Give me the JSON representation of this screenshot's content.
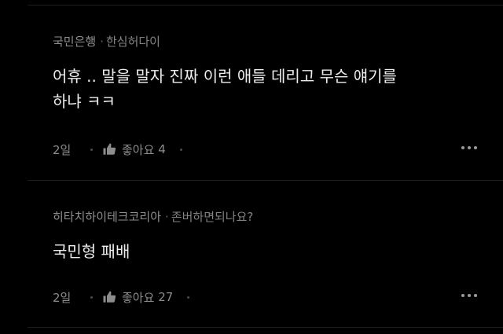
{
  "comments": [
    {
      "author": "국민은행",
      "separator": "·",
      "nickname": "한심허다이",
      "text": "어휴 .. 말을 말자 진짜 이런 애들 데리고 무슨 얘기를\n하냐 ㅋㅋ",
      "time": "2일",
      "like_label": "좋아요",
      "like_count": "4"
    },
    {
      "author": "히타치하이테크코리아",
      "separator": "·",
      "nickname": "존버하면되나요?",
      "text": "국민형 패배",
      "time": "2일",
      "like_label": "좋아요",
      "like_count": "27"
    }
  ],
  "icons": {
    "like": "thumbs-up-icon",
    "more": "more-horizontal-icon"
  },
  "colors": {
    "background": "#000000",
    "text": "#ededed",
    "muted": "#8a8a8a"
  }
}
